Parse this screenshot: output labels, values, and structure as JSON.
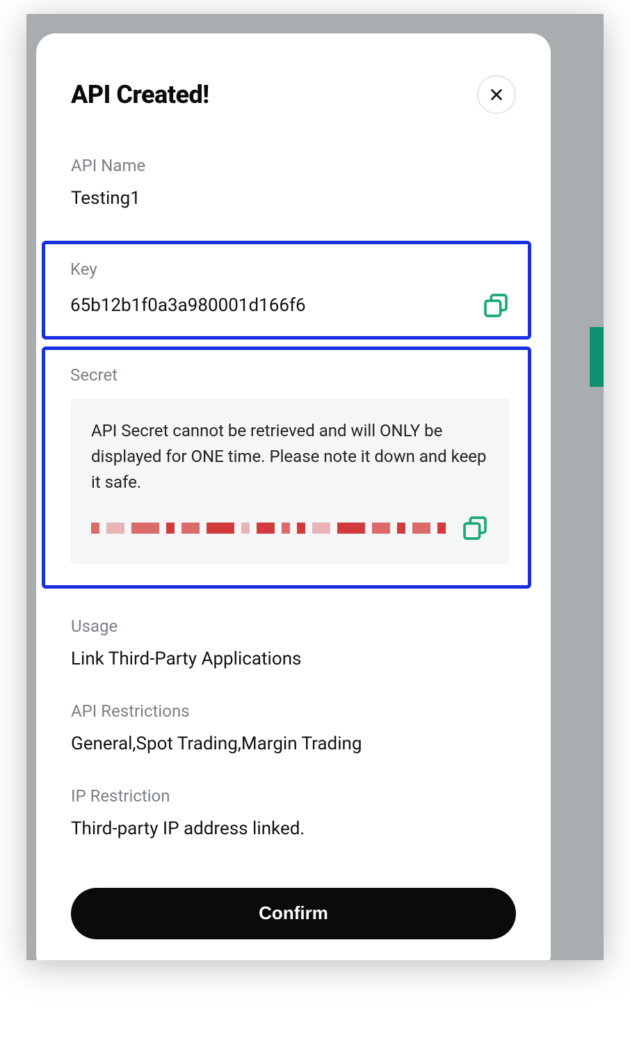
{
  "dialog": {
    "title": "API Created!",
    "close_label": "Close",
    "confirm_label": "Confirm"
  },
  "fields": {
    "api_name": {
      "label": "API Name",
      "value": "Testing1"
    },
    "key": {
      "label": "Key",
      "value": "65b12b1f0a3a980001d166f6"
    },
    "secret": {
      "label": "Secret",
      "warning": "API Secret cannot be retrieved and will ONLY be displayed for ONE time. Please note it down and keep it safe."
    },
    "usage": {
      "label": "Usage",
      "value": "Link Third-Party Applications"
    },
    "api_restrictions": {
      "label": "API Restrictions",
      "value": "General,Spot Trading,Margin Trading"
    },
    "ip_restriction": {
      "label": "IP Restriction",
      "value": "Third-party IP address linked."
    }
  },
  "icons": {
    "close": "close-icon",
    "copy": "copy-icon"
  },
  "colors": {
    "highlight_border": "#1a2fe0",
    "copy_icon": "#1aa876",
    "redacted": "#d23b3b",
    "confirm_bg": "#0b0b0b"
  }
}
